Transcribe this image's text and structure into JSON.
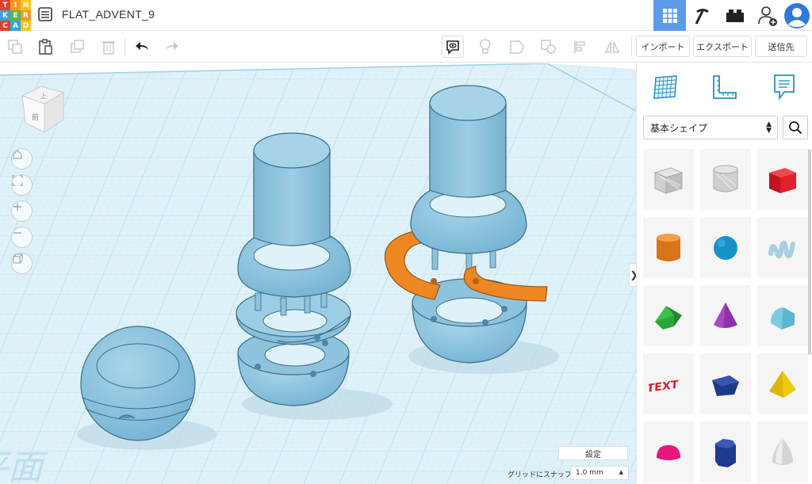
{
  "app": {
    "logo_letters": [
      "T",
      "I",
      "N",
      "K",
      "E",
      "R",
      "C",
      "A",
      "D"
    ],
    "logo_colors": [
      "#e2402d",
      "#f29a1f",
      "#f5c51a",
      "#31a6dc",
      "#58b847",
      "#f29a1f",
      "#e2402d",
      "#31a6dc",
      "#f5c51a"
    ],
    "document_title": "FLAT_ADVENT_9"
  },
  "header_views": [
    {
      "name": "3d-design-view",
      "icon": "grid-icon",
      "active": true
    },
    {
      "name": "codeblocks-view",
      "icon": "pickaxe-icon",
      "active": false
    },
    {
      "name": "bricks-view",
      "icon": "brick-icon",
      "active": false
    },
    {
      "name": "add-user",
      "icon": "add-user-icon",
      "active": false
    },
    {
      "name": "profile",
      "icon": "avatar-icon",
      "active": false
    }
  ],
  "toolbar": {
    "import_label": "インポート",
    "export_label": "エクスポート",
    "send_label": "送信先"
  },
  "navcube": {
    "top_label": "上",
    "front_label": "前"
  },
  "workplane": {
    "watermark": "作業平面",
    "settings_label": "設定",
    "snap_label": "グリッドにスナップ",
    "snap_value": "1.0 mm",
    "accent": "#8ec3dc",
    "grid_color": "#c9e6f3",
    "orange": "#ee8622"
  },
  "panel": {
    "shape_category": "基本シェイプ",
    "shapes": [
      {
        "name": "box-hole",
        "color": "#d8d8d8"
      },
      {
        "name": "cylinder-hole",
        "color": "#d8d8d8"
      },
      {
        "name": "box",
        "color": "#e0202a"
      },
      {
        "name": "cylinder",
        "color": "#ee8622"
      },
      {
        "name": "sphere",
        "color": "#1592c9"
      },
      {
        "name": "scribble",
        "color": "#a8cfe2"
      },
      {
        "name": "roof",
        "color": "#2aa63a"
      },
      {
        "name": "cone",
        "color": "#8d32a8"
      },
      {
        "name": "round-roof",
        "color": "#5ab7cf"
      },
      {
        "name": "text",
        "color": "#d92027"
      },
      {
        "name": "polygon",
        "color": "#1c3a8a"
      },
      {
        "name": "pyramid",
        "color": "#f0c80e"
      },
      {
        "name": "half-sphere",
        "color": "#e6157f"
      },
      {
        "name": "hexagonal-prism",
        "color": "#1b3a90"
      },
      {
        "name": "paraboloid",
        "color": "#d4d4d4"
      }
    ],
    "text_shape_label": "TEXT"
  }
}
